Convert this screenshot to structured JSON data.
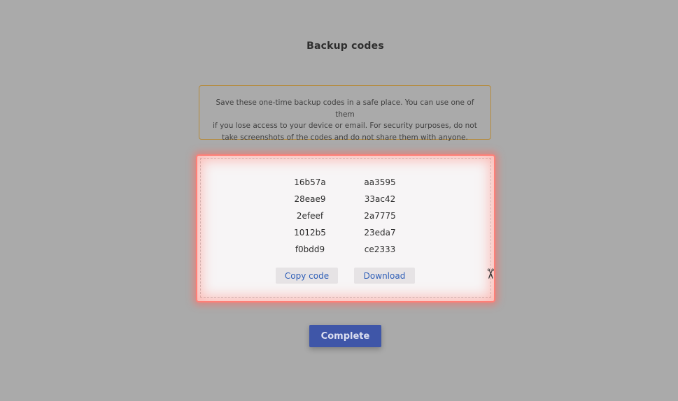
{
  "header": {
    "title": "Backup codes"
  },
  "notice": {
    "lines": [
      "Save these one-time backup codes in a safe place. You can use one of them",
      "if you lose access to your device or email. For security purposes, do not",
      "take screenshots of the codes and do not share them with anyone."
    ]
  },
  "codes": {
    "rows": [
      [
        "16b57a",
        "aa3595"
      ],
      [
        "28eae9",
        "33ac42"
      ],
      [
        "2efeef",
        "2a7775"
      ],
      [
        "1012b5",
        "23eda7"
      ],
      [
        "f0bdd9",
        "ce2333"
      ]
    ],
    "copy_label": "Copy code",
    "download_label": "Download",
    "cut_icon": "scissors-icon"
  },
  "footer": {
    "complete_label": "Complete"
  },
  "colors": {
    "background": "#aaaaaa",
    "notice_border": "#b58a3a",
    "highlight": "#ff7f77",
    "link": "#2f5fb8",
    "primary": "#3f56a8"
  }
}
